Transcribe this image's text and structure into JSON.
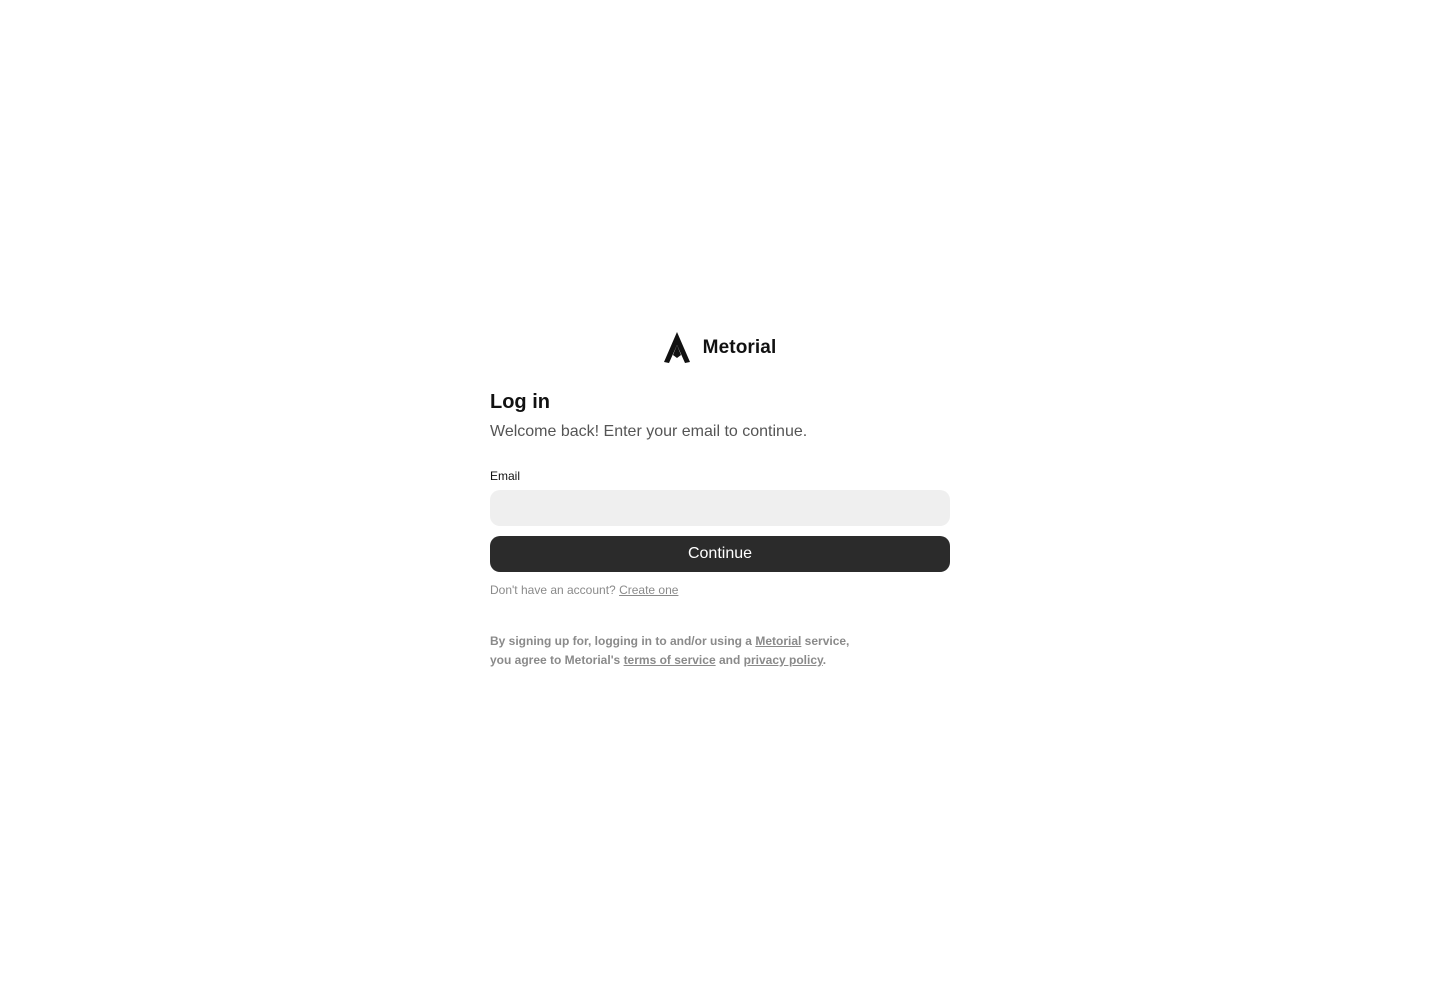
{
  "brand": {
    "name": "Metorial"
  },
  "login": {
    "title": "Log in",
    "subtitle": "Welcome back! Enter your email to continue.",
    "email_label": "Email",
    "email_value": "",
    "email_placeholder": "",
    "continue_label": "Continue"
  },
  "signup": {
    "prompt": "Don't have an account?",
    "link_label": "Create one"
  },
  "legal": {
    "part1": "By signing up for, logging in to and/or using a ",
    "service_link": "Metorial",
    "part2": " service, you agree to Metorial's ",
    "terms_link": "terms of service",
    "part3": " and ",
    "privacy_link": "privacy policy",
    "part4": "."
  },
  "colors": {
    "button_bg": "#2b2b2b",
    "input_bg": "#efefef",
    "muted_text": "#8a8a8a"
  }
}
